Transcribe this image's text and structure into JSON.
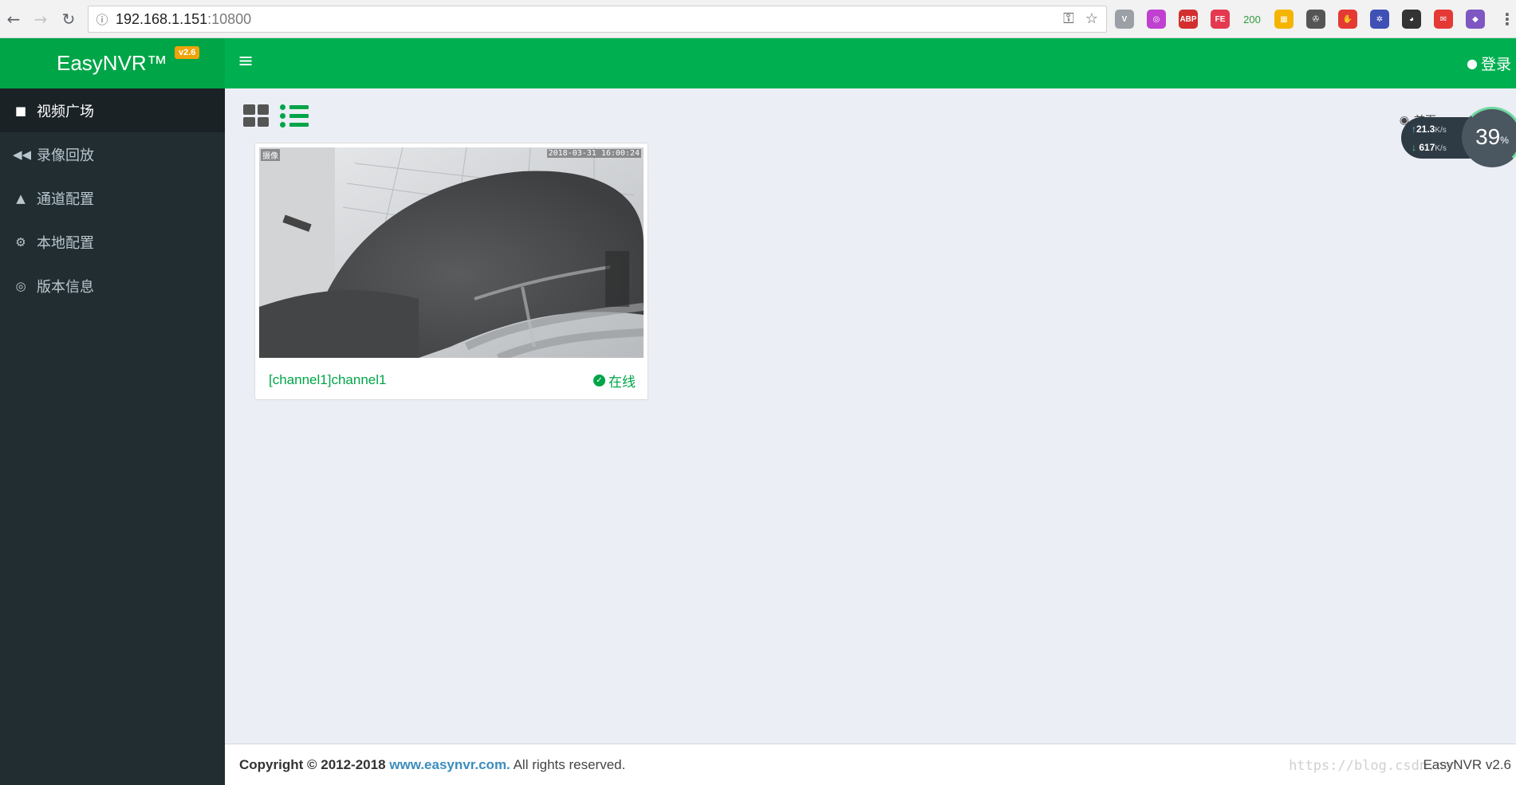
{
  "browser": {
    "url_host": "192.168.1.151",
    "url_port": ":10800",
    "extensions": [
      {
        "name": "vivaldi-v-icon",
        "text": "V",
        "color": "#9aa0a6"
      },
      {
        "name": "purple-swirl-icon",
        "text": "◎",
        "color": "#c040d0"
      },
      {
        "name": "abp-icon",
        "text": "ABP",
        "color": "#d32f2f"
      },
      {
        "name": "fe-icon",
        "text": "FE",
        "color": "#e53950"
      },
      {
        "name": "status-200-icon",
        "text": "200",
        "color": ""
      },
      {
        "name": "color-blocks-icon",
        "text": "▦",
        "color": "#f4b400"
      },
      {
        "name": "film-reel-icon",
        "text": "✇",
        "color": "#555555"
      },
      {
        "name": "red-hand-icon",
        "text": "✋",
        "color": "#e53935"
      },
      {
        "name": "blue-network-icon",
        "text": "✲",
        "color": "#3f51b5"
      },
      {
        "name": "panda-icon",
        "text": "◕",
        "color": "#333333"
      },
      {
        "name": "red-chat-icon",
        "text": "✉",
        "color": "#e53935"
      },
      {
        "name": "gradient-square-icon",
        "text": "◆",
        "color": "#7e57c2"
      }
    ]
  },
  "header": {
    "brand": "EasyNVR™",
    "version_badge": "v2.6",
    "login": "登录"
  },
  "sidebar": {
    "items": [
      {
        "label": "视频广场",
        "icon": "video-camera-icon",
        "glyph": "■",
        "active": true
      },
      {
        "label": "录像回放",
        "icon": "rewind-icon",
        "glyph": "◀◀",
        "active": false
      },
      {
        "label": "通道配置",
        "icon": "road-icon",
        "glyph": "▲",
        "active": false
      },
      {
        "label": "本地配置",
        "icon": "cogs-icon",
        "glyph": "⚙",
        "active": false
      },
      {
        "label": "版本信息",
        "icon": "life-ring-icon",
        "glyph": "◎",
        "active": false
      }
    ]
  },
  "content": {
    "breadcrumb_home": "首页",
    "channel_card": {
      "name": "[channel1]channel1",
      "status": "在线",
      "osd_timestamp": "2018-03-31 16:00:24",
      "osd_label": "摄像"
    }
  },
  "speed_widget": {
    "up_value": "21.3",
    "up_unit": "K/s",
    "down_value": "617",
    "down_unit": "K/s",
    "percent": "39",
    "percent_sign": "%"
  },
  "footer": {
    "copyright": "Copyright © 2012-2018",
    "link": "www.easynvr.com.",
    "rights": "All rights reserved.",
    "version": "EasyNVR v2.6",
    "watermark": "https://blog.csdn.net"
  },
  "colors": {
    "brand_green": "#00b050",
    "sidebar_bg": "#222d32",
    "badge_orange": "#f0a30a",
    "link_blue": "#3c8dbc"
  }
}
